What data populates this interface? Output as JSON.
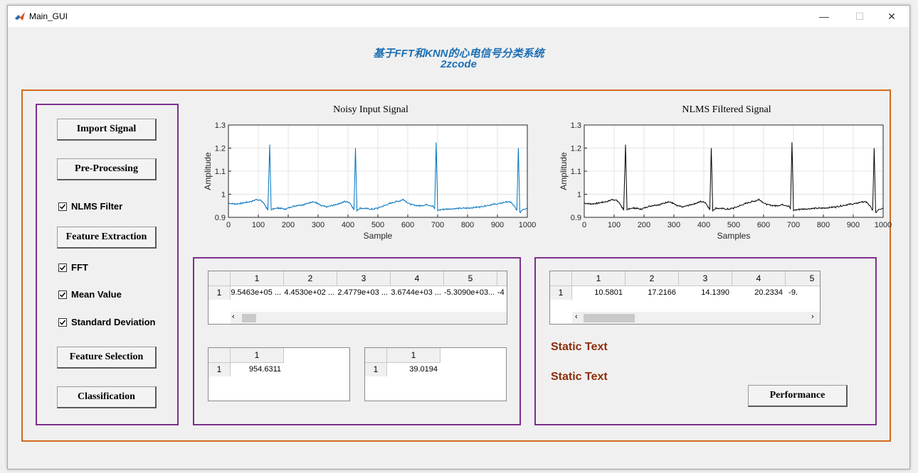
{
  "window": {
    "title": "Main_GUI",
    "minimize": "—",
    "maximize": "☐",
    "close": "✕"
  },
  "header": {
    "title_line1": "基于FFT和KNN的心电信号分类系统",
    "title_line2": "2zcode"
  },
  "left_panel": {
    "import_button": "Import Signal",
    "preprocess_button": "Pre-Processing",
    "nlms_checkbox": {
      "label": "NLMS Filter",
      "checked": true
    },
    "feature_extraction_button": "Feature Extraction",
    "fft_checkbox": {
      "label": "FFT",
      "checked": true
    },
    "mean_checkbox": {
      "label": "Mean Value",
      "checked": true
    },
    "std_checkbox": {
      "label": "Standard Deviation",
      "checked": true
    },
    "feature_selection_button": "Feature Selection",
    "classification_button": "Classification"
  },
  "chart_data": [
    {
      "type": "line",
      "title": "Noisy Input Signal",
      "xlabel": "Sample",
      "ylabel": "Amplitude",
      "xlim": [
        0,
        1000
      ],
      "ylim": [
        0.9,
        1.3
      ],
      "xticks": [
        "0",
        "100",
        "200",
        "300",
        "400",
        "500",
        "600",
        "700",
        "800",
        "900",
        "1000"
      ],
      "yticks": [
        "0.9",
        "1",
        "1.1",
        "1.2",
        "1.3"
      ],
      "grid": true,
      "color": "#0072bd",
      "r_peaks": [
        [
          138,
          1.215
        ],
        [
          425,
          1.2
        ],
        [
          695,
          1.225
        ],
        [
          970,
          1.2
        ]
      ],
      "points": [
        [
          0,
          0.962
        ],
        [
          20,
          0.958
        ],
        [
          40,
          0.96
        ],
        [
          60,
          0.965
        ],
        [
          80,
          0.97
        ],
        [
          95,
          0.978
        ],
        [
          110,
          0.972
        ],
        [
          120,
          0.958
        ],
        [
          128,
          0.94
        ],
        [
          132,
          0.93
        ],
        [
          138,
          1.215
        ],
        [
          143,
          0.93
        ],
        [
          150,
          0.938
        ],
        [
          170,
          0.94
        ],
        [
          190,
          0.935
        ],
        [
          210,
          0.945
        ],
        [
          230,
          0.952
        ],
        [
          250,
          0.955
        ],
        [
          265,
          0.96
        ],
        [
          280,
          0.968
        ],
        [
          295,
          0.962
        ],
        [
          310,
          0.95
        ],
        [
          330,
          0.945
        ],
        [
          350,
          0.952
        ],
        [
          370,
          0.96
        ],
        [
          390,
          0.968
        ],
        [
          405,
          0.965
        ],
        [
          415,
          0.945
        ],
        [
          420,
          0.932
        ],
        [
          425,
          1.2
        ],
        [
          430,
          0.93
        ],
        [
          440,
          0.94
        ],
        [
          460,
          0.938
        ],
        [
          480,
          0.935
        ],
        [
          500,
          0.94
        ],
        [
          520,
          0.95
        ],
        [
          540,
          0.96
        ],
        [
          560,
          0.968
        ],
        [
          575,
          0.972
        ],
        [
          585,
          0.978
        ],
        [
          595,
          0.968
        ],
        [
          610,
          0.955
        ],
        [
          640,
          0.95
        ],
        [
          665,
          0.955
        ],
        [
          685,
          0.948
        ],
        [
          690,
          0.935
        ],
        [
          695,
          1.225
        ],
        [
          700,
          0.93
        ],
        [
          720,
          0.935
        ],
        [
          760,
          0.938
        ],
        [
          800,
          0.94
        ],
        [
          840,
          0.945
        ],
        [
          880,
          0.955
        ],
        [
          910,
          0.96
        ],
        [
          930,
          0.968
        ],
        [
          945,
          0.965
        ],
        [
          958,
          0.945
        ],
        [
          965,
          0.93
        ],
        [
          970,
          1.2
        ],
        [
          975,
          0.92
        ],
        [
          985,
          0.935
        ],
        [
          1000,
          0.94
        ]
      ]
    },
    {
      "type": "line",
      "title": "NLMS Filtered Signal",
      "xlabel": "Samples",
      "ylabel": "Amplitude",
      "xlim": [
        0,
        1000
      ],
      "ylim": [
        0.9,
        1.3
      ],
      "xticks": [
        "0",
        "100",
        "200",
        "300",
        "400",
        "500",
        "600",
        "700",
        "800",
        "900",
        "1000"
      ],
      "yticks": [
        "0.9",
        "1",
        "1.1",
        "1.2",
        "1.3"
      ],
      "grid": true,
      "color": "#000000",
      "r_peaks": [
        [
          138,
          1.215
        ],
        [
          425,
          1.2
        ],
        [
          695,
          1.225
        ],
        [
          970,
          1.2
        ]
      ],
      "points": [
        [
          0,
          0.962
        ],
        [
          20,
          0.958
        ],
        [
          40,
          0.96
        ],
        [
          60,
          0.965
        ],
        [
          80,
          0.97
        ],
        [
          95,
          0.978
        ],
        [
          110,
          0.972
        ],
        [
          120,
          0.958
        ],
        [
          128,
          0.94
        ],
        [
          132,
          0.93
        ],
        [
          138,
          1.215
        ],
        [
          143,
          0.93
        ],
        [
          150,
          0.938
        ],
        [
          170,
          0.94
        ],
        [
          190,
          0.935
        ],
        [
          210,
          0.945
        ],
        [
          230,
          0.952
        ],
        [
          250,
          0.955
        ],
        [
          265,
          0.96
        ],
        [
          280,
          0.968
        ],
        [
          295,
          0.962
        ],
        [
          310,
          0.95
        ],
        [
          330,
          0.945
        ],
        [
          350,
          0.952
        ],
        [
          370,
          0.96
        ],
        [
          390,
          0.968
        ],
        [
          405,
          0.965
        ],
        [
          415,
          0.945
        ],
        [
          420,
          0.932
        ],
        [
          425,
          1.2
        ],
        [
          430,
          0.93
        ],
        [
          440,
          0.94
        ],
        [
          460,
          0.938
        ],
        [
          480,
          0.935
        ],
        [
          500,
          0.94
        ],
        [
          520,
          0.95
        ],
        [
          540,
          0.96
        ],
        [
          560,
          0.968
        ],
        [
          575,
          0.972
        ],
        [
          585,
          0.978
        ],
        [
          595,
          0.968
        ],
        [
          610,
          0.955
        ],
        [
          640,
          0.95
        ],
        [
          665,
          0.955
        ],
        [
          685,
          0.948
        ],
        [
          690,
          0.935
        ],
        [
          695,
          1.225
        ],
        [
          700,
          0.93
        ],
        [
          720,
          0.935
        ],
        [
          760,
          0.938
        ],
        [
          800,
          0.94
        ],
        [
          840,
          0.945
        ],
        [
          880,
          0.955
        ],
        [
          910,
          0.96
        ],
        [
          930,
          0.968
        ],
        [
          945,
          0.965
        ],
        [
          958,
          0.945
        ],
        [
          965,
          0.93
        ],
        [
          970,
          1.2
        ],
        [
          975,
          0.92
        ],
        [
          985,
          0.935
        ],
        [
          1000,
          0.94
        ]
      ]
    }
  ],
  "feature_table": {
    "columns": [
      "1",
      "2",
      "3",
      "4",
      "5"
    ],
    "row_label": "1",
    "values": [
      "9.5463e+05 ...",
      "4.4530e+02 ...",
      "2.4779e+03 ...",
      "3.6744e+03 ...",
      "-5.3090e+03...",
      "-4"
    ]
  },
  "mean_table": {
    "column": "1",
    "row_label": "1",
    "value": "954.6311"
  },
  "std_table": {
    "column": "1",
    "row_label": "1",
    "value": "39.0194"
  },
  "selected_table": {
    "columns": [
      "1",
      "2",
      "3",
      "4",
      "5"
    ],
    "row_label": "1",
    "values": [
      "10.5801",
      "17.2166",
      "14.1390",
      "20.2334",
      "-9."
    ]
  },
  "results": {
    "static_text_1": "Static Text",
    "static_text_2": "Static Text",
    "performance_button": "Performance"
  },
  "colors": {
    "outer_border": "#d2691e",
    "panel_border": "#7e2f8e",
    "title_blue": "#1d6fb3",
    "static_text": "#8b2e0a"
  }
}
